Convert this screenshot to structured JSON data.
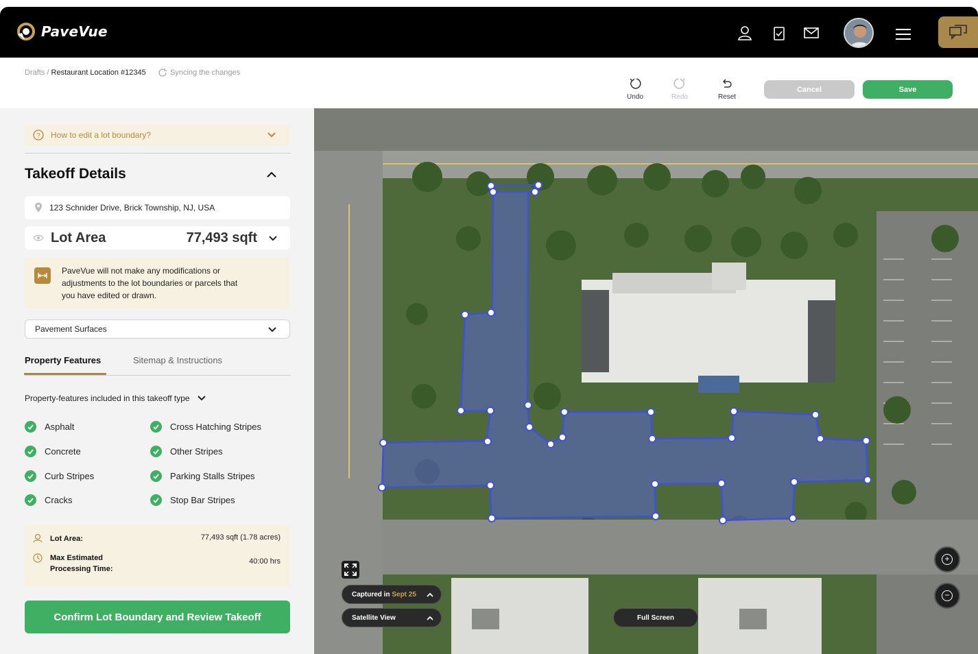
{
  "brand": {
    "name": "PaveVue",
    "accent": "#a8894b",
    "green": "#3fb063"
  },
  "nav": {
    "icons": [
      "user-icon",
      "clipboard-check-icon",
      "mail-icon",
      "menu-icon",
      "chat-icon"
    ]
  },
  "breadcrumb": {
    "root": "Drafts",
    "separator": " / ",
    "current": "Restaurant Location #12345"
  },
  "sync_status": "Syncing the changes",
  "toolbar": {
    "undo": "Undo",
    "redo": "Redo",
    "reset": "Reset",
    "cancel": "Cancel",
    "save": "Save"
  },
  "help": {
    "label": "How to edit a lot boundary?"
  },
  "takeoff": {
    "title": "Takeoff Details",
    "address": "123 Schnider Drive, Brick Township, NJ, USA",
    "lot_area_label": "Lot Area",
    "lot_area_value": "77,493 sqft",
    "notice": "PaveVue will not make any modifications or adjustments to the lot boundaries or parcels that you have edited or drawn.",
    "select_value": "Pavement Surfaces"
  },
  "tabs": {
    "active": "Property Features",
    "inactive": "Sitemap & Instructions"
  },
  "features": {
    "heading": "Property-features included in this takeoff type",
    "left": [
      "Asphalt",
      "Concrete",
      "Curb Stripes",
      "Cracks"
    ],
    "right": [
      "Cross Hatching Stripes",
      "Other Stripes",
      "Parking Stalls Stripes",
      "Stop Bar Stripes"
    ]
  },
  "summary": {
    "lot_area_label": "Lot Area:",
    "lot_area_value": "77,493 sqft (1.78 acres)",
    "time_label_1": "Max Estimated",
    "time_label_2": "Processing Time:",
    "time_value": "40:00 hrs"
  },
  "confirm_label": "Confirm Lot Boundary and Review Takeoff",
  "map": {
    "captured_prefix": "Captured in",
    "captured_date": "Sept 25",
    "view_mode": "Satellite View",
    "fullscreen": "Full Screen",
    "zoom_in": "+",
    "zoom_out": "−"
  }
}
